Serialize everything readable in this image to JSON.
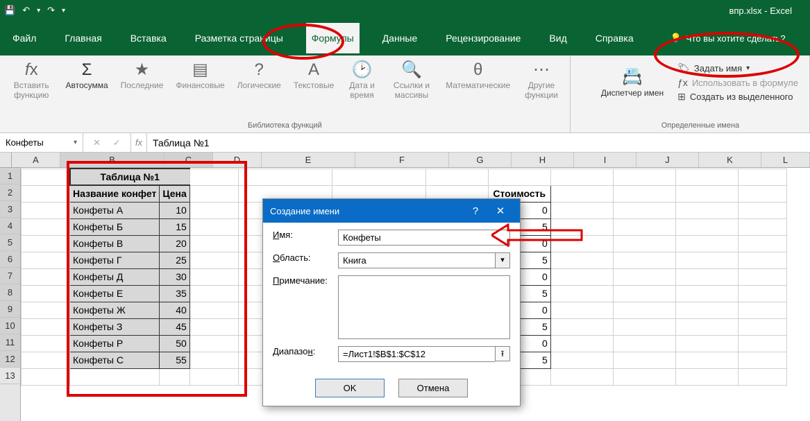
{
  "app": {
    "title": "впр.xlsx  -  Excel"
  },
  "qat": {
    "save": "💾",
    "undo": "↶",
    "redo": "↷",
    "more": "▾"
  },
  "tabs": [
    "Файл",
    "Главная",
    "Вставка",
    "Разметка страницы",
    "Формулы",
    "Данные",
    "Рецензирование",
    "Вид",
    "Справка"
  ],
  "active_tab": "Формулы",
  "tell_me": "Что вы хотите сделать?",
  "ribbon": {
    "insert_fn": "Вставить функцию",
    "autosum": "Автосумма",
    "recent": "Последние",
    "financial": "Финансовые",
    "logical": "Логические",
    "text": "Текстовые",
    "datetime": "Дата и время",
    "lookup": "Ссылки и массивы",
    "math": "Математические",
    "other": "Другие функции",
    "lib_label": "Библиотека функций",
    "name_mgr": "Диспетчер имен",
    "define_name": "Задать имя",
    "use_in_formula": "Использовать в формуле",
    "create_from_sel": "Создать из выделенного",
    "names_label": "Определенные имена"
  },
  "name_box": "Конфеты",
  "formula": "Таблица №1",
  "columns": [
    "A",
    "B",
    "C",
    "D",
    "E",
    "F",
    "G",
    "H",
    "I",
    "J",
    "K",
    "L"
  ],
  "rows": [
    1,
    2,
    3,
    4,
    5,
    6,
    7,
    8,
    9,
    10,
    11,
    12,
    13
  ],
  "table1": {
    "title": "Таблица №1",
    "h1": "Название конфет",
    "h2": "Цена",
    "rows": [
      [
        "Конфеты А",
        "10"
      ],
      [
        "Конфеты Б",
        "15"
      ],
      [
        "Конфеты В",
        "20"
      ],
      [
        "Конфеты Г",
        "25"
      ],
      [
        "Конфеты Д",
        "30"
      ],
      [
        "Конфеты Е",
        "35"
      ],
      [
        "Конфеты Ж",
        "40"
      ],
      [
        "Конфеты З",
        "45"
      ],
      [
        "Конфеты Р",
        "50"
      ],
      [
        "Конфеты С",
        "55"
      ]
    ]
  },
  "table2": {
    "h_cost": "Стоимость",
    "vals_h": [
      "0",
      "5",
      "0",
      "5",
      "0",
      "5",
      "0",
      "5",
      "0",
      "5"
    ]
  },
  "dialog": {
    "title": "Создание имени",
    "name_label": "Имя:",
    "name_value": "Конфеты",
    "scope_label": "Область:",
    "scope_value": "Книга",
    "comment_label": "Примечание:",
    "range_label": "Диапазон:",
    "range_value": "=Лист1!$B$1:$C$12",
    "ok": "OK",
    "cancel": "Отмена",
    "help": "?",
    "close": "✕"
  }
}
